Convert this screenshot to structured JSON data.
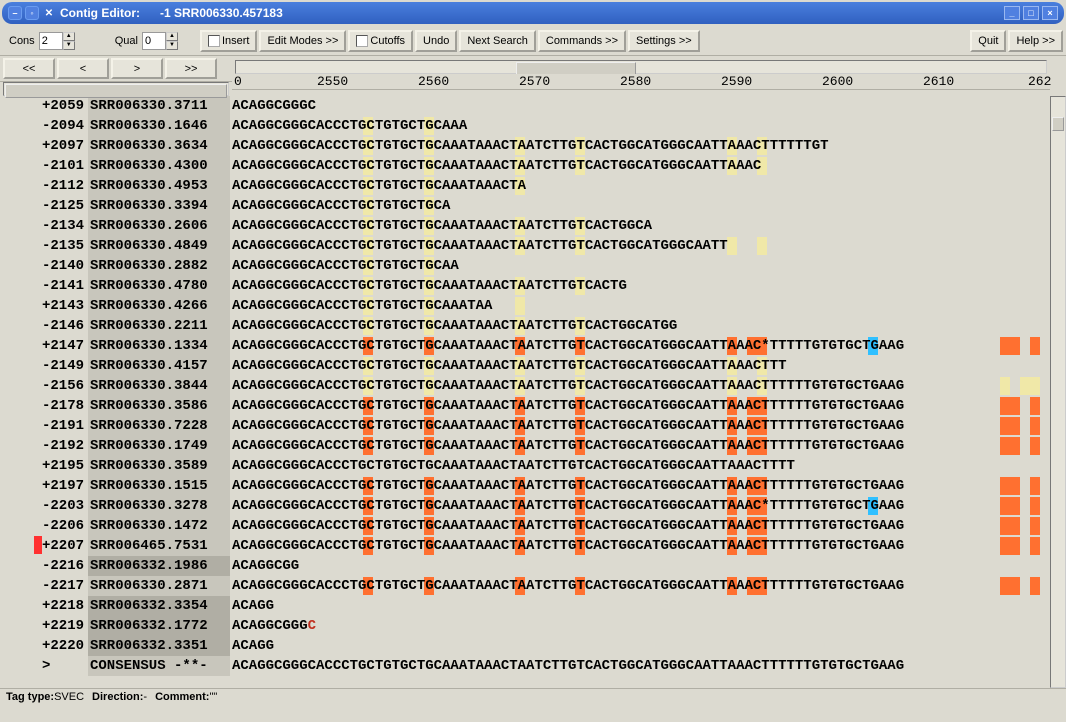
{
  "window": {
    "title": "Contig Editor:",
    "subtitle": "-1 SRR006330.457183"
  },
  "toolbar": {
    "cons_label": "Cons",
    "cons_value": "2",
    "qual_label": "Qual",
    "qual_value": "0",
    "insert_label": "Insert",
    "edit_modes_label": "Edit Modes >>",
    "cutoffs_label": "Cutoffs",
    "undo_label": "Undo",
    "next_search_label": "Next Search",
    "commands_label": "Commands >>",
    "settings_label": "Settings >>",
    "quit_label": "Quit",
    "help_label": "Help >>"
  },
  "nav": {
    "first": "<<",
    "prev": "<",
    "next": ">",
    "last": ">>"
  },
  "ruler": {
    "start": "0",
    "ticks": [
      "2550",
      "2560",
      "2570",
      "2580",
      "2590",
      "2600",
      "2610",
      "262"
    ]
  },
  "consensus": {
    "label": "CONSENSUS",
    "marker": "-**-",
    "seq": "ACAGGCGGGCACCCTGCTGTGCTGCAAATAAACTAATCTTGTCACTGGCATGGGCAATTAAACTTTTTTGTGTGCTGAAG"
  },
  "caret": ">",
  "reads": [
    {
      "num": "+2059",
      "name": "SRR006330.3711",
      "seq": "ACAGGCGGGC",
      "hl": []
    },
    {
      "num": "-2094",
      "name": "SRR006330.1646",
      "seq": "ACAGGCGGGCACCCTGCTGTGCTGCAAA",
      "hl": [
        [
          "y",
          13,
          1
        ],
        [
          "y",
          19,
          1
        ]
      ]
    },
    {
      "num": "+2097",
      "name": "SRR006330.3634",
      "seq": "ACAGGCGGGCACCCTGCTGTGCTGCAAATAAACTAATCTTGTCACTGGCATGGGCAATTAAACTTTTTTGT",
      "hl": [
        [
          "y",
          13,
          1
        ],
        [
          "y",
          19,
          1
        ],
        [
          "y",
          28,
          1
        ],
        [
          "y",
          34,
          1
        ],
        [
          "y",
          49,
          1
        ],
        [
          "y",
          52,
          1
        ]
      ]
    },
    {
      "num": "-2101",
      "name": "SRR006330.4300",
      "seq": "ACAGGCGGGCACCCTGCTGTGCTGCAAATAAACTAATCTTGTCACTGGCATGGGCAATTAAAC",
      "hl": [
        [
          "y",
          13,
          1
        ],
        [
          "y",
          19,
          1
        ],
        [
          "y",
          28,
          1
        ],
        [
          "y",
          34,
          1
        ],
        [
          "y",
          49,
          1
        ],
        [
          "y",
          52,
          1
        ]
      ]
    },
    {
      "num": "-2112",
      "name": "SRR006330.4953",
      "seq": "ACAGGCGGGCACCCTGCTGTGCTGCAAATAAACTA",
      "hl": [
        [
          "y",
          13,
          1
        ],
        [
          "y",
          19,
          1
        ],
        [
          "y",
          28,
          1
        ]
      ]
    },
    {
      "num": "-2125",
      "name": "SRR006330.3394",
      "seq": "ACAGGCGGGCACCCTGCTGTGCTGCA",
      "hl": [
        [
          "y",
          13,
          1
        ],
        [
          "y",
          19,
          1
        ]
      ]
    },
    {
      "num": "-2134",
      "name": "SRR006330.2606",
      "seq": "ACAGGCGGGCACCCTGCTGTGCTGCAAATAAACTAATCTTGTCACTGGCA",
      "hl": [
        [
          "y",
          13,
          1
        ],
        [
          "y",
          19,
          1
        ],
        [
          "y",
          28,
          1
        ],
        [
          "y",
          34,
          1
        ]
      ]
    },
    {
      "num": "-2135",
      "name": "SRR006330.4849",
      "seq": "ACAGGCGGGCACCCTGCTGTGCTGCAAATAAACTAATCTTGTCACTGGCATGGGCAATT",
      "hl": [
        [
          "y",
          13,
          1
        ],
        [
          "y",
          19,
          1
        ],
        [
          "y",
          28,
          1
        ],
        [
          "y",
          34,
          1
        ],
        [
          "y",
          49,
          1
        ],
        [
          "y",
          52,
          1
        ]
      ]
    },
    {
      "num": "-2140",
      "name": "SRR006330.2882",
      "seq": "ACAGGCGGGCACCCTGCTGTGCTGCAA",
      "hl": [
        [
          "y",
          13,
          1
        ],
        [
          "y",
          19,
          1
        ]
      ]
    },
    {
      "num": "-2141",
      "name": "SRR006330.4780",
      "seq": "ACAGGCGGGCACCCTGCTGTGCTGCAAATAAACTAATCTTGTCACTG",
      "hl": [
        [
          "y",
          13,
          1
        ],
        [
          "y",
          19,
          1
        ],
        [
          "y",
          28,
          1
        ],
        [
          "y",
          34,
          1
        ]
      ]
    },
    {
      "num": "+2143",
      "name": "SRR006330.4266",
      "seq": "ACAGGCGGGCACCCTGCTGTGCTGCAAATAA",
      "hl": [
        [
          "y",
          13,
          1
        ],
        [
          "y",
          19,
          1
        ],
        [
          "y",
          28,
          1
        ]
      ]
    },
    {
      "num": "-2146",
      "name": "SRR006330.2211",
      "seq": "ACAGGCGGGCACCCTGCTGTGCTGCAAATAAACTAATCTTGTCACTGGCATGG",
      "hl": [
        [
          "y",
          13,
          1
        ],
        [
          "y",
          19,
          1
        ],
        [
          "y",
          28,
          1
        ],
        [
          "y",
          34,
          1
        ]
      ]
    },
    {
      "num": "+2147",
      "name": "SRR006330.1334",
      "seq": "ACAGGCGGGCACCCTGCTGTGCTGCAAATAAACTAATCTTGTCACTGGCATGGGCAATTAAAC*TTTTTGTGTGCTGAAG",
      "hl": [
        [
          "o",
          13,
          1
        ],
        [
          "o",
          19,
          1
        ],
        [
          "o",
          28,
          1
        ],
        [
          "o",
          34,
          1
        ],
        [
          "o",
          49,
          1
        ],
        [
          "o",
          51,
          2
        ],
        [
          "b",
          63,
          1
        ],
        [
          "o",
          76,
          2
        ],
        [
          "o",
          79,
          1
        ]
      ]
    },
    {
      "num": "-2149",
      "name": "SRR006330.4157",
      "seq": "ACAGGCGGGCACCCTGCTGTGCTGCAAATAAACTAATCTTGTCACTGGCATGGGCAATTAAACTTT",
      "hl": [
        [
          "y",
          13,
          1
        ],
        [
          "y",
          19,
          1
        ],
        [
          "y",
          28,
          1
        ],
        [
          "y",
          34,
          1
        ],
        [
          "y",
          49,
          1
        ],
        [
          "y",
          52,
          1
        ]
      ]
    },
    {
      "num": "-2156",
      "name": "SRR006330.3844",
      "seq": "ACAGGCGGGCACCCTGCTGTGCTGCAAATAAACTAATCTTGTCACTGGCATGGGCAATTAAACTTTTTTGTGTGCTGAAG",
      "hl": [
        [
          "y",
          13,
          1
        ],
        [
          "y",
          19,
          1
        ],
        [
          "y",
          28,
          1
        ],
        [
          "y",
          34,
          1
        ],
        [
          "y",
          49,
          1
        ],
        [
          "y",
          52,
          1
        ],
        [
          "y",
          76,
          1
        ],
        [
          "y",
          78,
          2
        ]
      ]
    },
    {
      "num": "-2178",
      "name": "SRR006330.3586",
      "seq": "ACAGGCGGGCACCCTGCTGTGCTGCAAATAAACTAATCTTGTCACTGGCATGGGCAATTAAACTTTTTTGTGTGCTGAAG",
      "hl": [
        [
          "o",
          13,
          1
        ],
        [
          "o",
          19,
          1
        ],
        [
          "o",
          28,
          1
        ],
        [
          "o",
          34,
          1
        ],
        [
          "o",
          49,
          1
        ],
        [
          "o",
          51,
          2
        ],
        [
          "o",
          76,
          2
        ],
        [
          "o",
          79,
          1
        ]
      ]
    },
    {
      "num": "-2191",
      "name": "SRR006330.7228",
      "seq": "ACAGGCGGGCACCCTGCTGTGCTGCAAATAAACTAATCTTGTCACTGGCATGGGCAATTAAACTTTTTTGTGTGCTGAAG",
      "hl": [
        [
          "o",
          13,
          1
        ],
        [
          "o",
          19,
          1
        ],
        [
          "o",
          28,
          1
        ],
        [
          "o",
          34,
          1
        ],
        [
          "o",
          49,
          1
        ],
        [
          "o",
          51,
          2
        ],
        [
          "o",
          76,
          2
        ],
        [
          "o",
          79,
          1
        ]
      ]
    },
    {
      "num": "-2192",
      "name": "SRR006330.1749",
      "seq": "ACAGGCGGGCACCCTGCTGTGCTGCAAATAAACTAATCTTGTCACTGGCATGGGCAATTAAACTTTTTTGTGTGCTGAAG",
      "hl": [
        [
          "o",
          13,
          1
        ],
        [
          "o",
          19,
          1
        ],
        [
          "o",
          28,
          1
        ],
        [
          "o",
          34,
          1
        ],
        [
          "o",
          49,
          1
        ],
        [
          "o",
          51,
          2
        ],
        [
          "o",
          76,
          2
        ],
        [
          "o",
          79,
          1
        ]
      ]
    },
    {
      "num": "+2195",
      "name": "SRR006330.3589",
      "seq": "ACAGGCGGGCACCCTGCTGTGCTGCAAATAAACTAATCTTGTCACTGGCATGGGCAATTAAACTTTT",
      "hl": []
    },
    {
      "num": "+2197",
      "name": "SRR006330.1515",
      "seq": "ACAGGCGGGCACCCTGCTGTGCTGCAAATAAACTAATCTTGTCACTGGCATGGGCAATTAAACTTTTTTGTGTGCTGAAG",
      "hl": [
        [
          "o",
          13,
          1
        ],
        [
          "o",
          19,
          1
        ],
        [
          "o",
          28,
          1
        ],
        [
          "o",
          34,
          1
        ],
        [
          "o",
          49,
          1
        ],
        [
          "o",
          51,
          2
        ],
        [
          "o",
          76,
          2
        ],
        [
          "o",
          79,
          1
        ]
      ]
    },
    {
      "num": "-2203",
      "name": "SRR006330.3278",
      "seq": "ACAGGCGGGCACCCTGCTGTGCTGCAAATAAACTAATCTTGTCACTGGCATGGGCAATTAAAC*TTTTTGTGTGCTGAAG",
      "hl": [
        [
          "o",
          13,
          1
        ],
        [
          "o",
          19,
          1
        ],
        [
          "o",
          28,
          1
        ],
        [
          "o",
          34,
          1
        ],
        [
          "o",
          49,
          1
        ],
        [
          "o",
          51,
          2
        ],
        [
          "b",
          63,
          1
        ],
        [
          "o",
          76,
          2
        ],
        [
          "o",
          79,
          1
        ]
      ]
    },
    {
      "num": "-2206",
      "name": "SRR006330.1472",
      "seq": "ACAGGCGGGCACCCTGCTGTGCTGCAAATAAACTAATCTTGTCACTGGCATGGGCAATTAAACTTTTTTGTGTGCTGAAG",
      "hl": [
        [
          "o",
          13,
          1
        ],
        [
          "o",
          19,
          1
        ],
        [
          "o",
          28,
          1
        ],
        [
          "o",
          34,
          1
        ],
        [
          "o",
          49,
          1
        ],
        [
          "o",
          51,
          2
        ],
        [
          "o",
          76,
          2
        ],
        [
          "o",
          79,
          1
        ]
      ]
    },
    {
      "num": "+2207",
      "name": "SRR006465.7531",
      "seq": "ACAGGCGGGCACCCTGCTGTGCTGCAAATAAACTAATCTTGTCACTGGCATGGGCAATTAAACTTTTTTGTGTGCTGAAG",
      "hl": [
        [
          "o",
          13,
          1
        ],
        [
          "o",
          19,
          1
        ],
        [
          "o",
          28,
          1
        ],
        [
          "o",
          34,
          1
        ],
        [
          "o",
          49,
          1
        ],
        [
          "o",
          51,
          2
        ],
        [
          "o",
          76,
          2
        ],
        [
          "o",
          79,
          1
        ]
      ],
      "mark": true
    },
    {
      "num": "-2216",
      "name": "SRR006332.1986",
      "seq": "ACAGGCGG",
      "hl": [],
      "dark": true
    },
    {
      "num": "-2217",
      "name": "SRR006330.2871",
      "seq": "ACAGGCGGGCACCCTGCTGTGCTGCAAATAAACTAATCTTGTCACTGGCATGGGCAATTAAACTTTTTTGTGTGCTGAAG",
      "hl": [
        [
          "o",
          13,
          1
        ],
        [
          "o",
          19,
          1
        ],
        [
          "o",
          28,
          1
        ],
        [
          "o",
          34,
          1
        ],
        [
          "o",
          49,
          1
        ],
        [
          "o",
          51,
          2
        ],
        [
          "o",
          76,
          2
        ],
        [
          "o",
          79,
          1
        ]
      ]
    },
    {
      "num": "+2218",
      "name": "SRR006332.3354",
      "seq": "ACAGG",
      "hl": [],
      "dark": true
    },
    {
      "num": "+2219",
      "name": "SRR006332.1772",
      "seq": "ACAGGCGGG",
      "trail": "C",
      "hl": [],
      "dark": true
    },
    {
      "num": "+2220",
      "name": "SRR006332.3351",
      "seq": "ACAGG",
      "hl": [],
      "dark": true
    }
  ],
  "status": {
    "tag_type_label": "Tag type:",
    "tag_type_value": "SVEC",
    "direction_label": "Direction:",
    "direction_value": "-",
    "comment_label": "Comment:",
    "comment_value": "\"\""
  }
}
